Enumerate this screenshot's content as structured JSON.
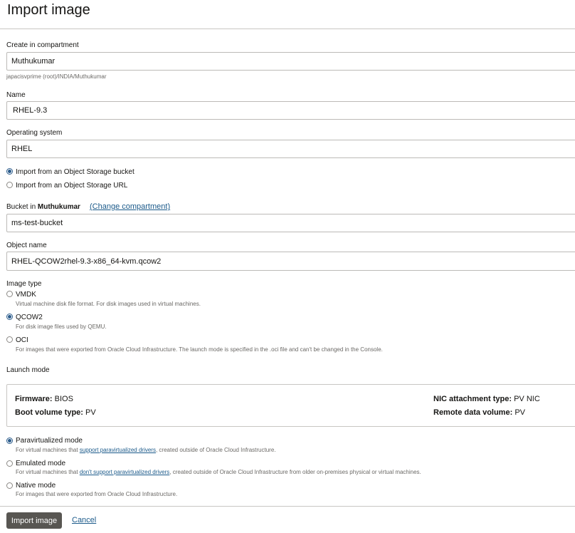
{
  "page": {
    "title": "Import image"
  },
  "compartment": {
    "label": "Create in compartment",
    "value": "Muthukumar",
    "path": "japacisvprime (root)/INDIA/Muthukumar"
  },
  "name": {
    "label": "Name",
    "value": "RHEL-9.3"
  },
  "os": {
    "label": "Operating system",
    "value": "RHEL"
  },
  "source": {
    "options": [
      {
        "label": "Import from an Object Storage bucket",
        "checked": true
      },
      {
        "label": "Import from an Object Storage URL",
        "checked": false
      }
    ]
  },
  "bucket": {
    "label_prefix": "Bucket in",
    "compartment": "Muthukumar",
    "change_link": "(Change compartment)",
    "value": "ms-test-bucket"
  },
  "object": {
    "label": "Object name",
    "value": "RHEL-QCOW2rhel-9.3-x86_64-kvm.qcow2"
  },
  "image_type": {
    "label": "Image type",
    "options": [
      {
        "label": "VMDK",
        "desc": "Virtual machine disk file format. For disk images used in virtual machines.",
        "checked": false
      },
      {
        "label": "QCOW2",
        "desc": "For disk image files used by QEMU.",
        "checked": true
      },
      {
        "label": "OCI",
        "desc": "For images that were exported from Oracle Cloud Infrastructure. The launch mode is specified in the .oci file and can't be changed in the Console.",
        "checked": false
      }
    ]
  },
  "launch": {
    "label": "Launch mode",
    "firmware_key": "Firmware:",
    "firmware_val": "BIOS",
    "boot_key": "Boot volume type:",
    "boot_val": "PV",
    "nic_key": "NIC attachment type:",
    "nic_val": "PV NIC",
    "remote_key": "Remote data volume:",
    "remote_val": "PV"
  },
  "modes": {
    "paravirtualized": {
      "label": "Paravirtualized mode",
      "desc_pre": "For virtual machines that ",
      "desc_link": "support paravirtualized drivers",
      "desc_post": ", created outside of Oracle Cloud Infrastructure.",
      "checked": true
    },
    "emulated": {
      "label": "Emulated mode",
      "desc_pre": "For virtual machines that ",
      "desc_link": "don't support paravirtualized drivers",
      "desc_post": ", created outside of Oracle Cloud Infrastructure from older on-premises physical or virtual machines.",
      "checked": false
    },
    "native": {
      "label": "Native mode",
      "desc": "For images that were exported from Oracle Cloud Infrastructure.",
      "checked": false
    }
  },
  "footer": {
    "import_label": "Import image",
    "cancel_label": "Cancel"
  },
  "colors": {
    "primary_button": "#585652",
    "link": "#1b5a8a",
    "radio_checked": "#2a5b8b"
  }
}
